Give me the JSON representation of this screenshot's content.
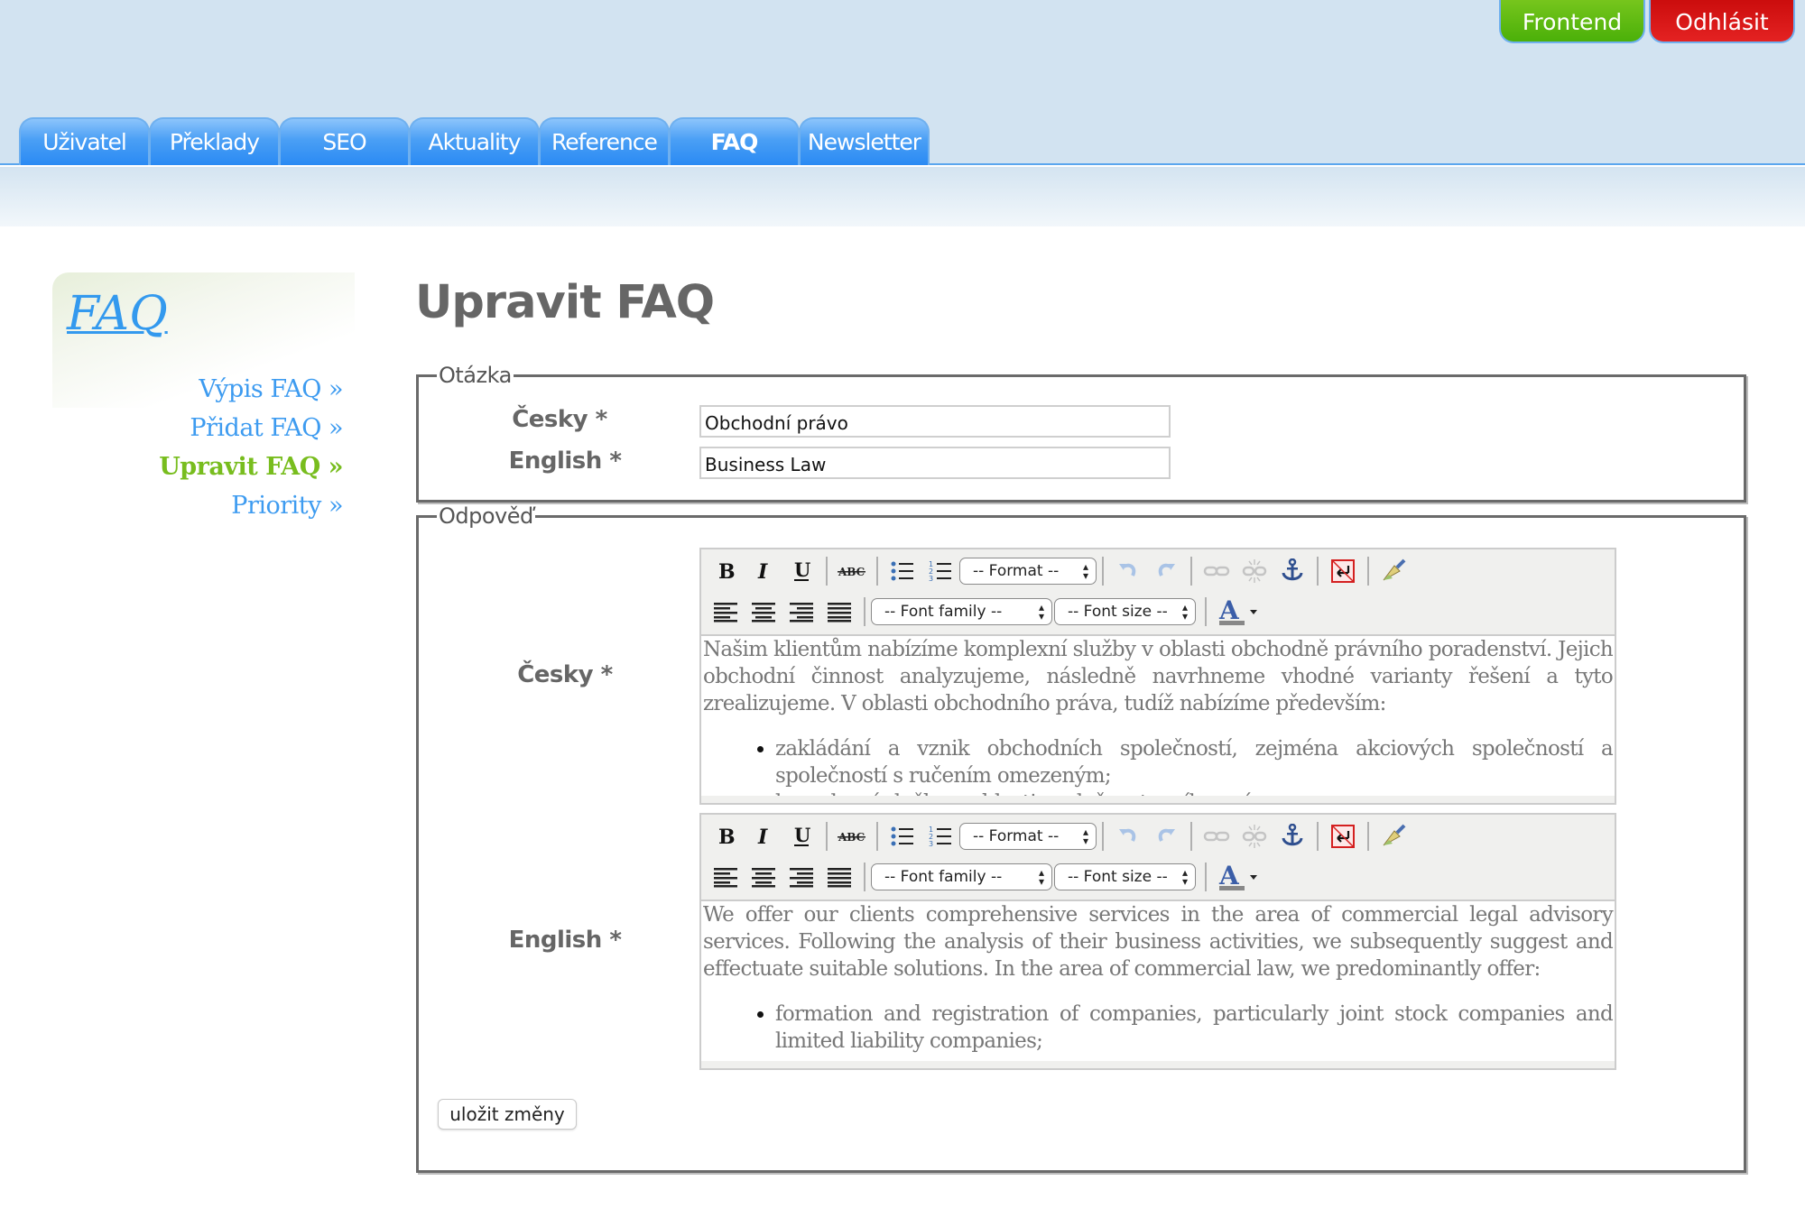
{
  "header": {
    "frontend_label": "Frontend",
    "logout_label": "Odhlásit",
    "tabs": [
      {
        "label": "Uživatel",
        "active": false
      },
      {
        "label": "Překlady",
        "active": false
      },
      {
        "label": "SEO",
        "active": false
      },
      {
        "label": "Aktuality",
        "active": false
      },
      {
        "label": "Reference",
        "active": false
      },
      {
        "label": "FAQ",
        "active": true
      },
      {
        "label": "Newsletter",
        "active": false
      }
    ]
  },
  "sidebar": {
    "title": "FAQ",
    "items": [
      {
        "label": "Výpis FAQ »",
        "active": false
      },
      {
        "label": "Přidat FAQ »",
        "active": false
      },
      {
        "label": "Upravit FAQ »",
        "active": true
      },
      {
        "label": "Priority »",
        "active": false
      }
    ]
  },
  "main": {
    "title": "Upravit FAQ",
    "question": {
      "legend": "Otázka",
      "cz_label": "Česky *",
      "cz_value": "Obchodní právo",
      "en_label": "English *",
      "en_value": "Business Law"
    },
    "answer": {
      "legend": "Odpověď",
      "cz_label": "Česky *",
      "en_label": "English *",
      "cz_content": {
        "paragraph": "Našim klientům nabízíme komplexní služby v oblasti obchodně právního poradenství. Jejich obchodní činnost analyzujeme, následně navrhneme vhodné varianty řešení a tyto zrealizujeme. V oblasti obchodního práva, tudíž nabízíme především:",
        "bullets": [
          "zakládání a vznik obchodních společností, zejména akciových společností a společností s ručením omezeným;",
          "komplexní služby v oblasti společenstevního práva;"
        ]
      },
      "en_content": {
        "paragraph": "We offer our clients comprehensive services in the area of commercial legal advisory services. Following the analysis of their business activities, we subsequently suggest and effectuate suitable solutions. In the area of commercial law, we predominantly offer:",
        "bullets": [
          "formation and registration of companies, particularly joint stock companies and limited liability companies;"
        ]
      }
    },
    "save_label": "uložit změny"
  },
  "editor_toolbar": {
    "format_select": "-- Format --",
    "font_family_select": "-- Font family --",
    "font_size_select": "-- Font size --",
    "icons": [
      "bold-icon",
      "italic-icon",
      "underline-icon",
      "strikethrough-icon",
      "bullet-list-icon",
      "numbered-list-icon",
      "undo-icon",
      "redo-icon",
      "link-icon",
      "unlink-icon",
      "anchor-icon",
      "cleanup-icon",
      "paint-brush-icon",
      "align-left-icon",
      "align-center-icon",
      "align-right-icon",
      "align-justify-icon",
      "text-color-icon"
    ]
  },
  "colors": {
    "header_bg": "#d2e3f1",
    "tab_blue": "#2a8af3",
    "frontend_green": "#5bb812",
    "logout_red": "#d81414",
    "link_blue": "#3d9bf0",
    "active_green": "#78bd1e",
    "label_gray": "#666666"
  }
}
